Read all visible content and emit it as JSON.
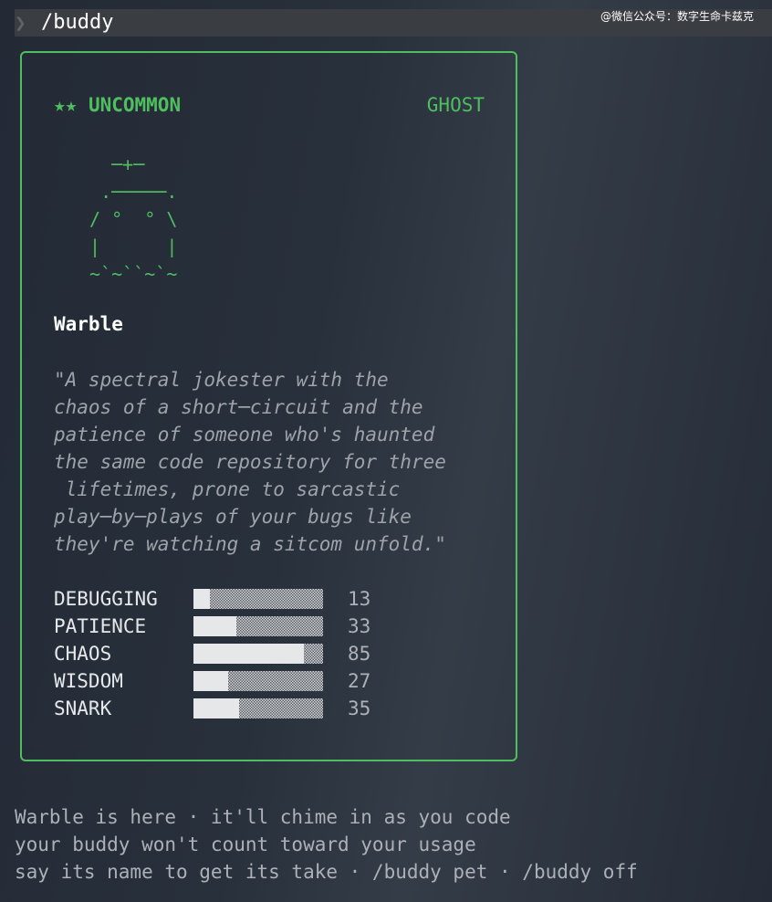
{
  "command": {
    "prompt_icon": "chevron-right-icon",
    "prompt_glyph": "❯",
    "text": "/buddy"
  },
  "watermark": "@微信公众号：数字生命卡兹克",
  "colors": {
    "accent": "#4fbe5f",
    "text": "#d4d7dc",
    "muted": "#9fa3a9"
  },
  "card": {
    "rarity_stars": "★★",
    "rarity": "UNCOMMON",
    "species": "GHOST",
    "ascii_art": "   ─+─\n  .─────.\n / °  ° \\\n |      |\n ~`~``~`~",
    "name": "Warble",
    "description": "\"A spectral jokester with the\nchaos of a short─circuit and the\npatience of someone who's haunted\nthe same code repository for three\n lifetimes, prone to sarcastic\nplay─by─plays of your bugs like\nthey're watching a sitcom unfold.\"",
    "stats": [
      {
        "name": "DEBUGGING",
        "value": 13,
        "display": "13"
      },
      {
        "name": "PATIENCE",
        "value": 33,
        "display": "33"
      },
      {
        "name": "CHAOS",
        "value": 85,
        "display": "85"
      },
      {
        "name": "WISDOM",
        "value": 27,
        "display": "27"
      },
      {
        "name": "SNARK",
        "value": 35,
        "display": "35"
      }
    ]
  },
  "footer": {
    "line1": "Warble is here · it'll chime in as you code",
    "line2": "your buddy won't count toward your usage",
    "line3": "say its name to get its take · /buddy pet · /buddy off"
  }
}
